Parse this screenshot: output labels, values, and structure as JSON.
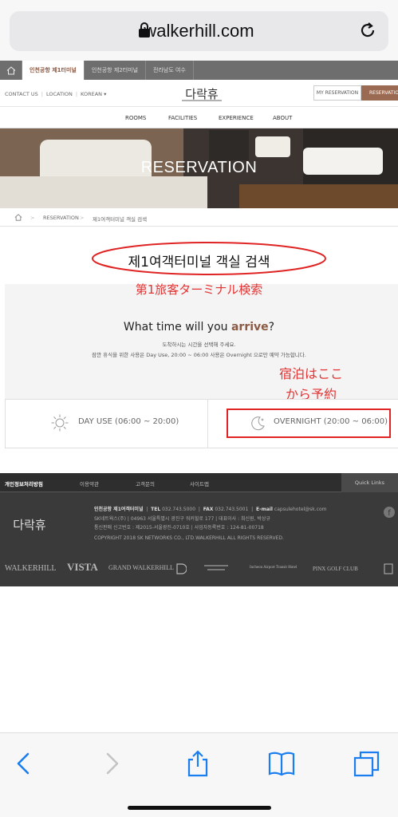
{
  "browser": {
    "url": "walkerhill.com"
  },
  "site_tabs": [
    "인천공항 제1터미널",
    "인천공항 제2터미널",
    "전라남도 여수"
  ],
  "util_links": [
    "CONTACT US",
    "LOCATION",
    "KOREAN ▾"
  ],
  "header": {
    "logo": "다락휴",
    "my_reservation": "MY RESERVATION",
    "reservation": "RESERVATION"
  },
  "nav": [
    "ROOMS",
    "FACILITIES",
    "EXPERIENCE",
    "ABOUT"
  ],
  "hero": {
    "title": "RESERVATION"
  },
  "breadcrumb": [
    "RESERVATION",
    "제1여객터미널 객실 검색"
  ],
  "page": {
    "title": "제1여객터미널 객실 검색",
    "annotation_title": "第1旅客ターミナル検索",
    "question_prefix": "What time will you ",
    "question_em": "arrive",
    "question_suffix": "?",
    "sub1": "도착하시는 시간을 선택해 주세요.",
    "sub2": "잠깐 휴식을 위한 사용은 Day Use, 20:00 ~ 06:00 사용은 Overnight 으로만 예약 가능합니다.",
    "annotation_overnight_1": "宿泊はここ",
    "annotation_overnight_2": "から予約",
    "option_day": "DAY USE (06:00 ~ 20:00)",
    "option_night": "OVERNIGHT (20:00 ~ 06:00)"
  },
  "footer": {
    "links": [
      "개인정보처리방침",
      "이용약관",
      "고객문의",
      "사이트맵"
    ],
    "quick_links": "Quick Links",
    "logo": "다락휴",
    "name": "인천공항 제1여객터미널",
    "tel_label": "TEL",
    "tel": "032.743.5000",
    "fax_label": "FAX",
    "fax": "032.743.5001",
    "email_label": "E-mail",
    "email": "capsulehotel@sk.com",
    "line2": "SK네트웍스(주)   |   04963 서울특별시 광진구 워커힐로 177   |   대표이사 : 최신원, 박상규",
    "line3": "통신판매 신고번호 : 제2015-서울광진-0710호   |   사업자등록번호 : 124-81-00718",
    "copyright": "COPYRIGHT 2018 SK NETWORKS CO., LTD.WALKERHILL ALL RIGHTS RESERVED.",
    "brands": [
      "WALKERHILL",
      "VISTA",
      "GRAND WALKERHILL",
      "Incheon Airport Transit Hotel",
      "PINX GOLF CLUB"
    ]
  }
}
